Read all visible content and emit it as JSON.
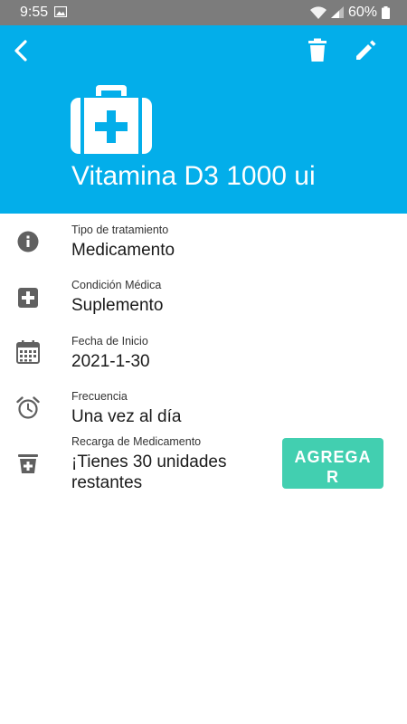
{
  "status_bar": {
    "time": "9:55",
    "battery": "60%"
  },
  "header": {
    "title": "Vitamina D3 1000 ui",
    "background_color": "#03aeea",
    "icons": [
      "back-arrow-icon",
      "trash-icon",
      "pencil-icon",
      "medical-kit-icon"
    ]
  },
  "details": [
    {
      "label": "Tipo de tratamiento",
      "value": "Medicamento",
      "icon": "info-icon"
    },
    {
      "label": "Condición Médica",
      "value": "Suplemento",
      "icon": "medical-cross-icon"
    },
    {
      "label": "Fecha de Inicio",
      "value": "2021-1-30",
      "icon": "calendar-icon"
    },
    {
      "label": "Frecuencia",
      "value": "Una vez al día",
      "icon": "alarm-clock-icon"
    },
    {
      "label": "Recarga de Medicamento",
      "value": "¡Tienes 30 unidades restantes",
      "icon": "pill-refill-icon"
    }
  ],
  "refill": {
    "button_label": "AGREGAR",
    "button_color": "#42cfb0"
  }
}
